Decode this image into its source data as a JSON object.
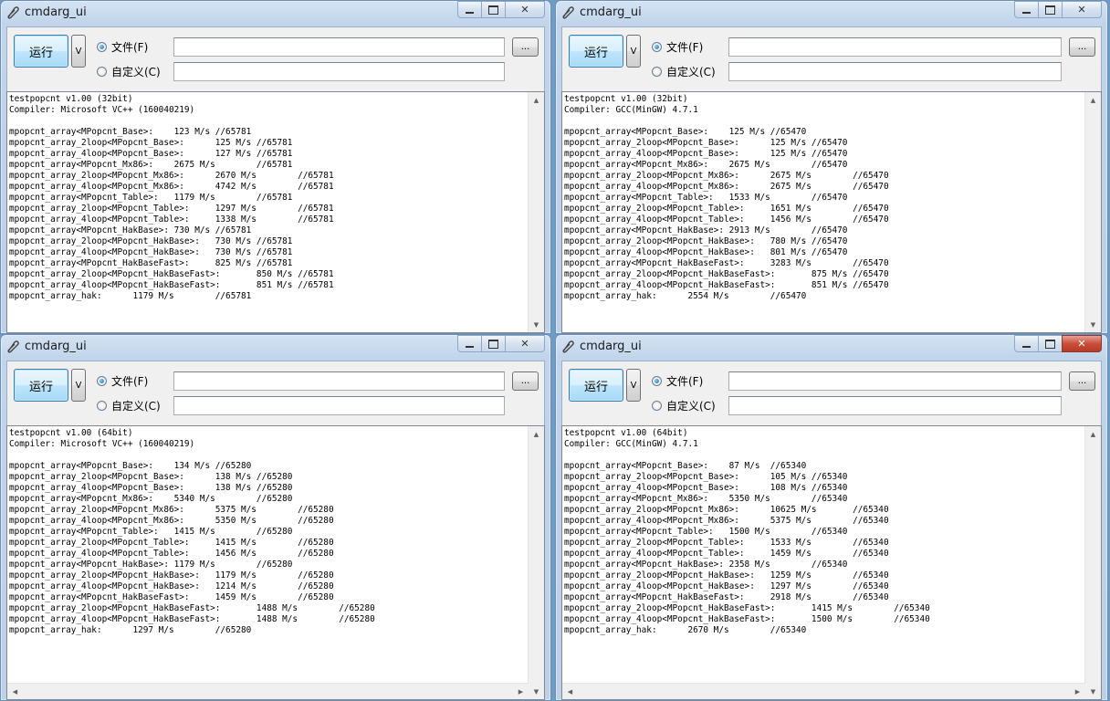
{
  "windows": [
    {
      "title": "cmdarg_ui",
      "run_label": "运行",
      "v_label": "V",
      "radio_file_label": "文件(F)",
      "radio_custom_label": "自定义(C)",
      "browse_label": "...",
      "file_value": "",
      "custom_value": "",
      "active": false,
      "has_hscroll": false,
      "output_lines": [
        "testpopcnt v1.00 (32bit)",
        "Compiler: Microsoft VC++ (160040219)",
        "",
        "mpopcnt_array<MPopcnt_Base>:    123 M/s //65781",
        "mpopcnt_array_2loop<MPopcnt_Base>:      125 M/s //65781",
        "mpopcnt_array_4loop<MPopcnt_Base>:      127 M/s //65781",
        "mpopcnt_array<MPopcnt_Mx86>:    2675 M/s        //65781",
        "mpopcnt_array_2loop<MPopcnt_Mx86>:      2670 M/s        //65781",
        "mpopcnt_array_4loop<MPopcnt_Mx86>:      4742 M/s        //65781",
        "mpopcnt_array<MPopcnt_Table>:   1179 M/s        //65781",
        "mpopcnt_array_2loop<MPopcnt_Table>:     1297 M/s        //65781",
        "mpopcnt_array_4loop<MPopcnt_Table>:     1338 M/s        //65781",
        "mpopcnt_array<MPopcnt_HakBase>: 730 M/s //65781",
        "mpopcnt_array_2loop<MPopcnt_HakBase>:   730 M/s //65781",
        "mpopcnt_array_4loop<MPopcnt_HakBase>:   730 M/s //65781",
        "mpopcnt_array<MPopcnt_HakBaseFast>:     825 M/s //65781",
        "mpopcnt_array_2loop<MPopcnt_HakBaseFast>:       850 M/s //65781",
        "mpopcnt_array_4loop<MPopcnt_HakBaseFast>:       851 M/s //65781",
        "mpopcnt_array_hak:      1179 M/s        //65781"
      ]
    },
    {
      "title": "cmdarg_ui",
      "run_label": "运行",
      "v_label": "V",
      "radio_file_label": "文件(F)",
      "radio_custom_label": "自定义(C)",
      "browse_label": "...",
      "file_value": "",
      "custom_value": "",
      "active": false,
      "has_hscroll": false,
      "output_lines": [
        "testpopcnt v1.00 (32bit)",
        "Compiler: GCC(MinGW) 4.7.1",
        "",
        "mpopcnt_array<MPopcnt_Base>:    125 M/s //65470",
        "mpopcnt_array_2loop<MPopcnt_Base>:      125 M/s //65470",
        "mpopcnt_array_4loop<MPopcnt_Base>:      125 M/s //65470",
        "mpopcnt_array<MPopcnt_Mx86>:    2675 M/s        //65470",
        "mpopcnt_array_2loop<MPopcnt_Mx86>:      2675 M/s        //65470",
        "mpopcnt_array_4loop<MPopcnt_Mx86>:      2675 M/s        //65470",
        "mpopcnt_array<MPopcnt_Table>:   1533 M/s        //65470",
        "mpopcnt_array_2loop<MPopcnt_Table>:     1651 M/s        //65470",
        "mpopcnt_array_4loop<MPopcnt_Table>:     1456 M/s        //65470",
        "mpopcnt_array<MPopcnt_HakBase>: 2913 M/s        //65470",
        "mpopcnt_array_2loop<MPopcnt_HakBase>:   780 M/s //65470",
        "mpopcnt_array_4loop<MPopcnt_HakBase>:   801 M/s //65470",
        "mpopcnt_array<MPopcnt_HakBaseFast>:     3283 M/s        //65470",
        "mpopcnt_array_2loop<MPopcnt_HakBaseFast>:       875 M/s //65470",
        "mpopcnt_array_4loop<MPopcnt_HakBaseFast>:       851 M/s //65470",
        "mpopcnt_array_hak:      2554 M/s        //65470"
      ]
    },
    {
      "title": "cmdarg_ui",
      "run_label": "运行",
      "v_label": "V",
      "radio_file_label": "文件(F)",
      "radio_custom_label": "自定义(C)",
      "browse_label": "...",
      "file_value": "",
      "custom_value": "",
      "active": false,
      "has_hscroll": true,
      "output_lines": [
        "testpopcnt v1.00 (64bit)",
        "Compiler: Microsoft VC++ (160040219)",
        "",
        "mpopcnt_array<MPopcnt_Base>:    134 M/s //65280",
        "mpopcnt_array_2loop<MPopcnt_Base>:      138 M/s //65280",
        "mpopcnt_array_4loop<MPopcnt_Base>:      138 M/s //65280",
        "mpopcnt_array<MPopcnt_Mx86>:    5340 M/s        //65280",
        "mpopcnt_array_2loop<MPopcnt_Mx86>:      5375 M/s        //65280",
        "mpopcnt_array_4loop<MPopcnt_Mx86>:      5350 M/s        //65280",
        "mpopcnt_array<MPopcnt_Table>:   1415 M/s        //65280",
        "mpopcnt_array_2loop<MPopcnt_Table>:     1415 M/s        //65280",
        "mpopcnt_array_4loop<MPopcnt_Table>:     1456 M/s        //65280",
        "mpopcnt_array<MPopcnt_HakBase>: 1179 M/s        //65280",
        "mpopcnt_array_2loop<MPopcnt_HakBase>:   1179 M/s        //65280",
        "mpopcnt_array_4loop<MPopcnt_HakBase>:   1214 M/s        //65280",
        "mpopcnt_array<MPopcnt_HakBaseFast>:     1459 M/s        //65280",
        "mpopcnt_array_2loop<MPopcnt_HakBaseFast>:       1488 M/s        //65280",
        "mpopcnt_array_4loop<MPopcnt_HakBaseFast>:       1488 M/s        //65280",
        "mpopcnt_array_hak:      1297 M/s        //65280"
      ]
    },
    {
      "title": "cmdarg_ui",
      "run_label": "运行",
      "v_label": "V",
      "radio_file_label": "文件(F)",
      "radio_custom_label": "自定义(C)",
      "browse_label": "...",
      "file_value": "",
      "custom_value": "",
      "active": true,
      "has_hscroll": true,
      "output_lines": [
        "testpopcnt v1.00 (64bit)",
        "Compiler: GCC(MinGW) 4.7.1",
        "",
        "mpopcnt_array<MPopcnt_Base>:    87 M/s  //65340",
        "mpopcnt_array_2loop<MPopcnt_Base>:      105 M/s //65340",
        "mpopcnt_array_4loop<MPopcnt_Base>:      108 M/s //65340",
        "mpopcnt_array<MPopcnt_Mx86>:    5350 M/s        //65340",
        "mpopcnt_array_2loop<MPopcnt_Mx86>:      10625 M/s       //65340",
        "mpopcnt_array_4loop<MPopcnt_Mx86>:      5375 M/s        //65340",
        "mpopcnt_array<MPopcnt_Table>:   1500 M/s        //65340",
        "mpopcnt_array_2loop<MPopcnt_Table>:     1533 M/s        //65340",
        "mpopcnt_array_4loop<MPopcnt_Table>:     1459 M/s        //65340",
        "mpopcnt_array<MPopcnt_HakBase>: 2358 M/s        //65340",
        "mpopcnt_array_2loop<MPopcnt_HakBase>:   1259 M/s        //65340",
        "mpopcnt_array_4loop<MPopcnt_HakBase>:   1297 M/s        //65340",
        "mpopcnt_array<MPopcnt_HakBaseFast>:     2918 M/s        //65340",
        "mpopcnt_array_2loop<MPopcnt_HakBaseFast>:       1415 M/s        //65340",
        "mpopcnt_array_4loop<MPopcnt_HakBaseFast>:       1500 M/s        //65340",
        "mpopcnt_array_hak:      2670 M/s        //65340"
      ]
    }
  ]
}
